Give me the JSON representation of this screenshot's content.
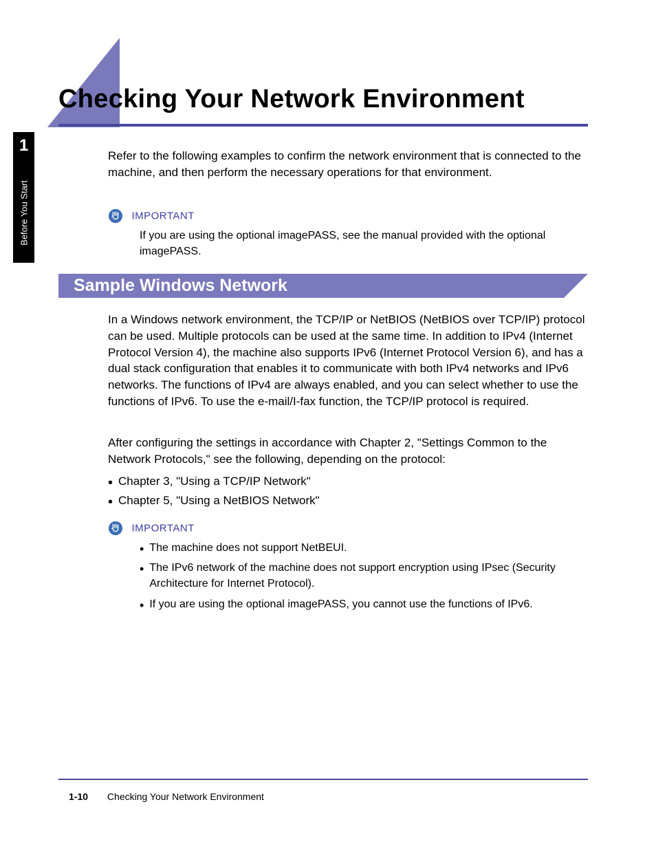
{
  "sidebar": {
    "chapter_number": "1",
    "side_label": "Before You Start"
  },
  "page_title": "Checking Your Network Environment",
  "intro_paragraph": "Refer to the following examples to confirm the network environment that is connected to the machine, and then perform the necessary operations for that environment.",
  "important_label": "IMPORTANT",
  "important1_text": "If you are using the optional imagePASS, see the manual provided with the optional imagePASS.",
  "section_heading": "Sample Windows Network",
  "body_para1": "In a Windows network environment, the TCP/IP or NetBIOS (NetBIOS over TCP/IP) protocol can be used. Multiple protocols can be used at the same time. In addition to IPv4 (Internet Protocol Version 4), the machine also supports IPv6 (Internet Protocol Version 6), and has a dual stack configuration that enables it to communicate with both IPv4 networks and IPv6 networks. The functions of IPv4 are always enabled, and you can select whether to use the functions of IPv6. To use the e-mail/I-fax function, the TCP/IP protocol is required.",
  "body_para2": "After configuring the settings in accordance with Chapter 2, \"Settings Common to the Network Protocols,\" see the following, depending on the protocol:",
  "chapter_bullets": [
    "Chapter 3, \"Using a TCP/IP Network\"",
    "Chapter 5, \"Using a NetBIOS Network\""
  ],
  "important2_bullets": [
    "The machine does not support NetBEUI.",
    "The IPv6 network of the machine does not support encryption using IPsec (Security Architecture for Internet Protocol).",
    "If you are using the optional imagePASS, you cannot use the functions of IPv6."
  ],
  "footer": {
    "page_number": "1-10",
    "title": "Checking Your Network Environment"
  }
}
